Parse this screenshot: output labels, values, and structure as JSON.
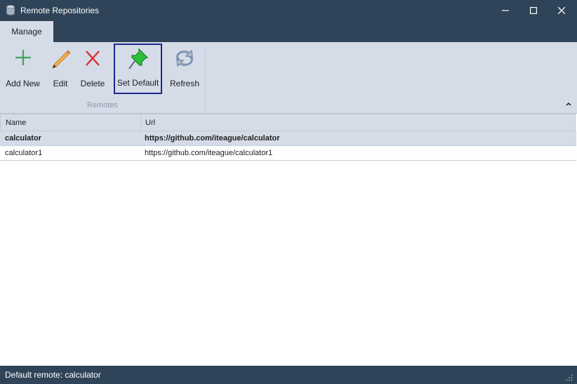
{
  "window": {
    "title": "Remote Repositories",
    "icon": "database-icon",
    "controls": [
      "minimize-icon",
      "maximize-icon",
      "close-icon"
    ]
  },
  "ribbon": {
    "tabs": [
      {
        "label": "Manage",
        "active": true
      }
    ],
    "group_label": "Remotes",
    "buttons": [
      {
        "label": "Add New",
        "icon": "plus-icon",
        "color": "#3aa55a"
      },
      {
        "label": "Edit",
        "icon": "pencil-icon",
        "color": "#e39a2c"
      },
      {
        "label": "Delete",
        "icon": "x-icon",
        "color": "#d9302c"
      },
      {
        "label": "Set Default",
        "icon": "pushpin-icon",
        "color": "#2bbf3a",
        "selected": true
      },
      {
        "label": "Refresh",
        "icon": "refresh-icon",
        "color": "#6f86a6"
      }
    ]
  },
  "grid": {
    "columns": [
      "Name",
      "Url"
    ],
    "rows": [
      {
        "name": "calculator",
        "url": "https://github.com/iteague/calculator",
        "selected": true
      },
      {
        "name": "calculator1",
        "url": "https://github.com/iteague/calculator1",
        "selected": false
      }
    ]
  },
  "status": {
    "text": "Default remote: calculator"
  },
  "colors": {
    "chrome": "#2f4458",
    "ribbon": "#d5dce8",
    "selection_border": "#1b2a8c"
  }
}
